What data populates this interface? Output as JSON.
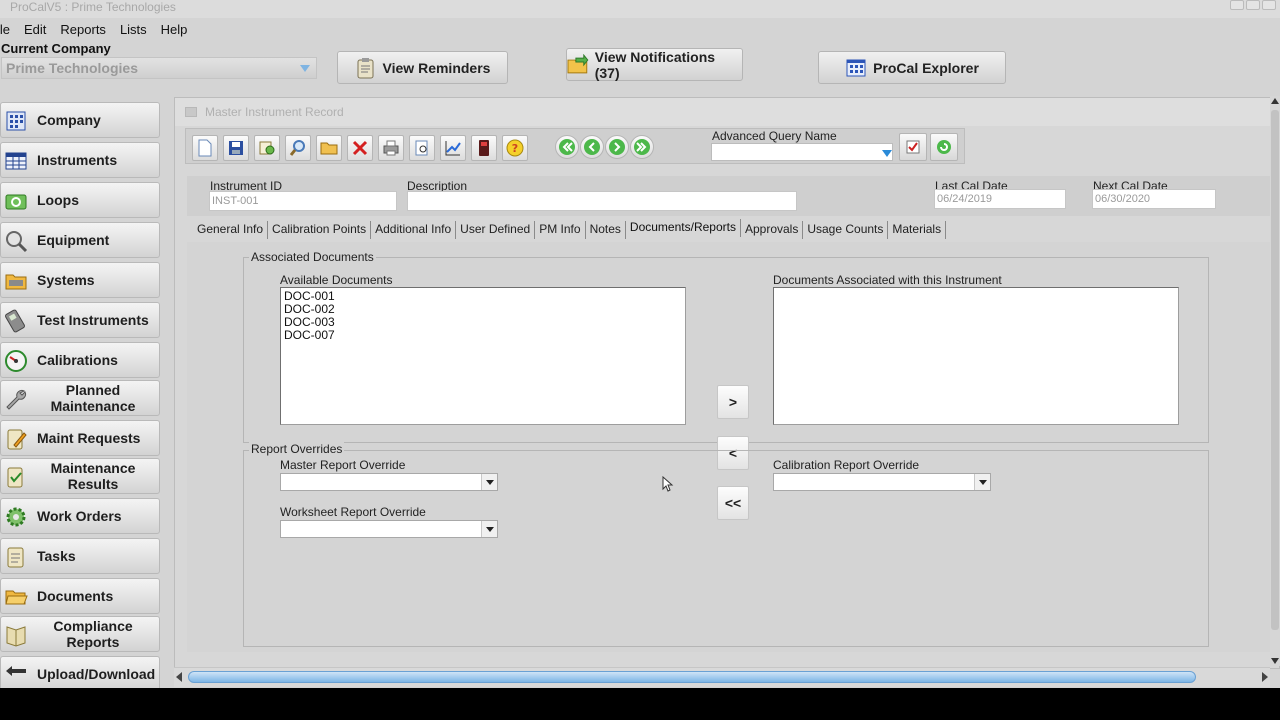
{
  "window": {
    "title": "ProCalV5 : Prime Technologies"
  },
  "menu": [
    "File",
    "Edit",
    "Reports",
    "Lists",
    "Help"
  ],
  "company": {
    "label": "Current Company",
    "value": "Prime Technologies"
  },
  "top_buttons": {
    "reminders": "View Reminders",
    "notifications": "View Notifications (37)",
    "explorer": "ProCal Explorer"
  },
  "sidebar": [
    {
      "label": "Company",
      "icon": "building-grid-icon"
    },
    {
      "label": "Instruments",
      "icon": "instrument-grid-icon"
    },
    {
      "label": "Loops",
      "icon": "loop-icon"
    },
    {
      "label": "Equipment",
      "icon": "magnifier-icon"
    },
    {
      "label": "Systems",
      "icon": "folder-icon"
    },
    {
      "label": "Test Instruments",
      "icon": "multimeter-icon"
    },
    {
      "label": "Calibrations",
      "icon": "gauge-icon"
    },
    {
      "label": "Planned Maintenance",
      "icon": "wrench-icon"
    },
    {
      "label": "Maint Requests",
      "icon": "clipboard-pencil-icon"
    },
    {
      "label": "Maintenance Results",
      "icon": "clipboard-check-icon"
    },
    {
      "label": "Work Orders",
      "icon": "gear-icon"
    },
    {
      "label": "Tasks",
      "icon": "clipboard-icon"
    },
    {
      "label": "Documents",
      "icon": "folder-open-icon"
    },
    {
      "label": "Compliance Reports",
      "icon": "book-icon"
    },
    {
      "label": "Upload/Download",
      "icon": "arrows-icon"
    }
  ],
  "record": {
    "title": "Master Instrument Record",
    "advanced_query_label": "Advanced Query Name",
    "advanced_query_value": "",
    "fields": {
      "instrument_id_label": "Instrument ID",
      "instrument_id": "INST-001",
      "description_label": "Description",
      "description": "",
      "last_cal_label": "Last Cal Date",
      "last_cal": "06/24/2019",
      "next_cal_label": "Next Cal Date",
      "next_cal": "06/30/2020"
    },
    "tabs": [
      "General Info",
      "Calibration Points",
      "Additional Info",
      "User Defined",
      "PM Info",
      "Notes",
      "Documents/Reports",
      "Approvals",
      "Usage Counts",
      "Materials"
    ],
    "active_tab": "Documents/Reports"
  },
  "documents": {
    "group_label": "Associated Documents",
    "available_label": "Available Documents",
    "available": [
      "DOC-001",
      "DOC-002",
      "DOC-003",
      "DOC-007"
    ],
    "associated_label": "Documents Associated with this Instrument",
    "associated": [],
    "move_buttons": {
      "add": ">",
      "remove": "<",
      "remove_all": "<<"
    }
  },
  "overrides": {
    "group_label": "Report Overrides",
    "master_label": "Master Report Override",
    "master_value": "",
    "calibration_label": "Calibration Report Override",
    "calibration_value": "",
    "worksheet_label": "Worksheet Report Override",
    "worksheet_value": ""
  },
  "colors": {
    "accent_scroll": "#7eb6e6",
    "background": "#d4d4d4"
  }
}
